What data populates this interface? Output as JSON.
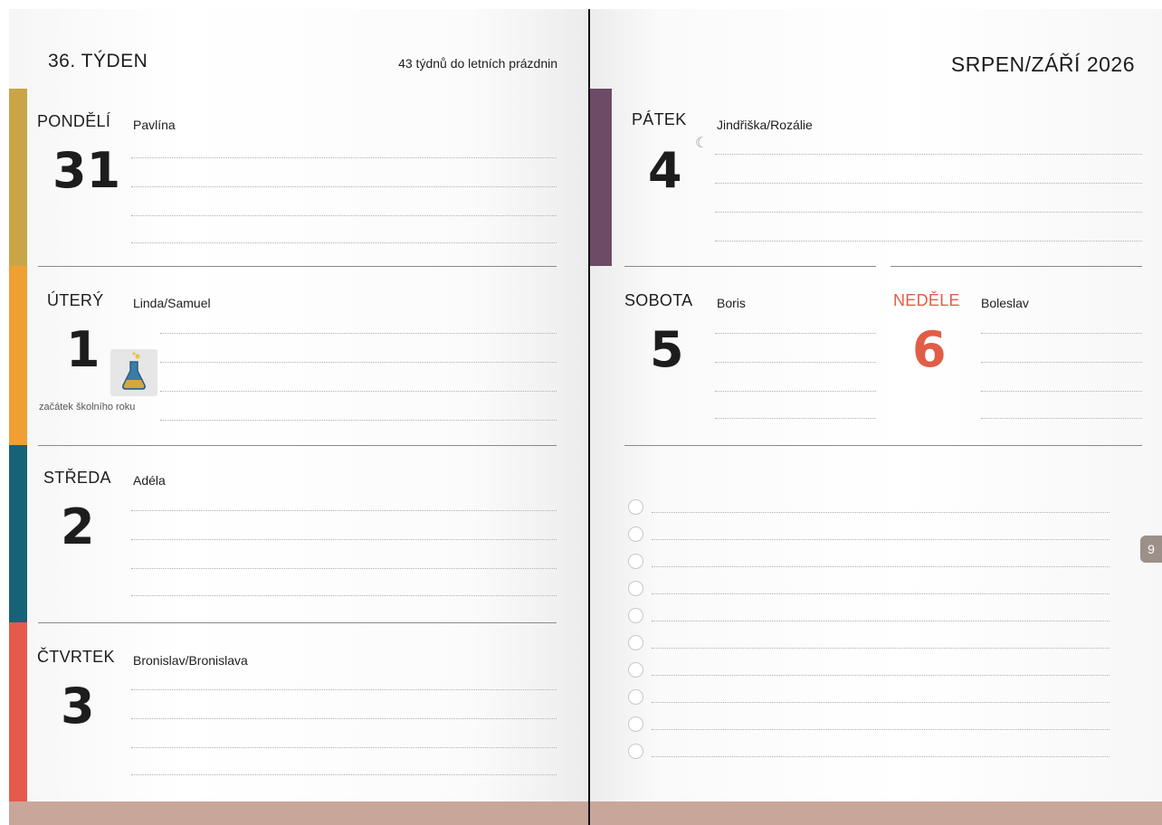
{
  "left_page": {
    "week_title": "36. TÝDEN",
    "weeks_until_holidays": "43 týdnů do letních prázdnin",
    "days": [
      {
        "day_name": "PONDĚLÍ",
        "date": "31",
        "name_day": "Pavlína",
        "tab_color": "#c9a547"
      },
      {
        "day_name": "ÚTERÝ",
        "date": "1",
        "name_day": "Linda/Samuel",
        "tab_color": "#f0a032",
        "note": "začátek školního roku",
        "icon": "flask-icon"
      },
      {
        "day_name": "STŘEDA",
        "date": "2",
        "name_day": "Adéla",
        "tab_color": "#166378"
      },
      {
        "day_name": "ČTVRTEK",
        "date": "3",
        "name_day": "Bronislav/Bronislava",
        "tab_color": "#e55a4d"
      }
    ]
  },
  "right_page": {
    "month_title": "SRPEN/ZÁŘÍ 2026",
    "friday": {
      "day_name": "PÁTEK",
      "date": "4",
      "name_day": "Jindřiška/Rozálie",
      "tab_color": "#6d4a66",
      "icon": "crescent-moon-icon",
      "moon_symbol": "☾"
    },
    "saturday": {
      "day_name": "SOBOTA",
      "date": "5",
      "name_day": "Boris"
    },
    "sunday": {
      "day_name": "NEDĚLE",
      "date": "6",
      "name_day": "Boleslav",
      "color": "#e15d47"
    },
    "checklist_count": 10,
    "page_number": "9"
  },
  "colors": {
    "bottom_band": "#c9a69a",
    "spine": "#111111",
    "page_tab": "#9c9089"
  }
}
